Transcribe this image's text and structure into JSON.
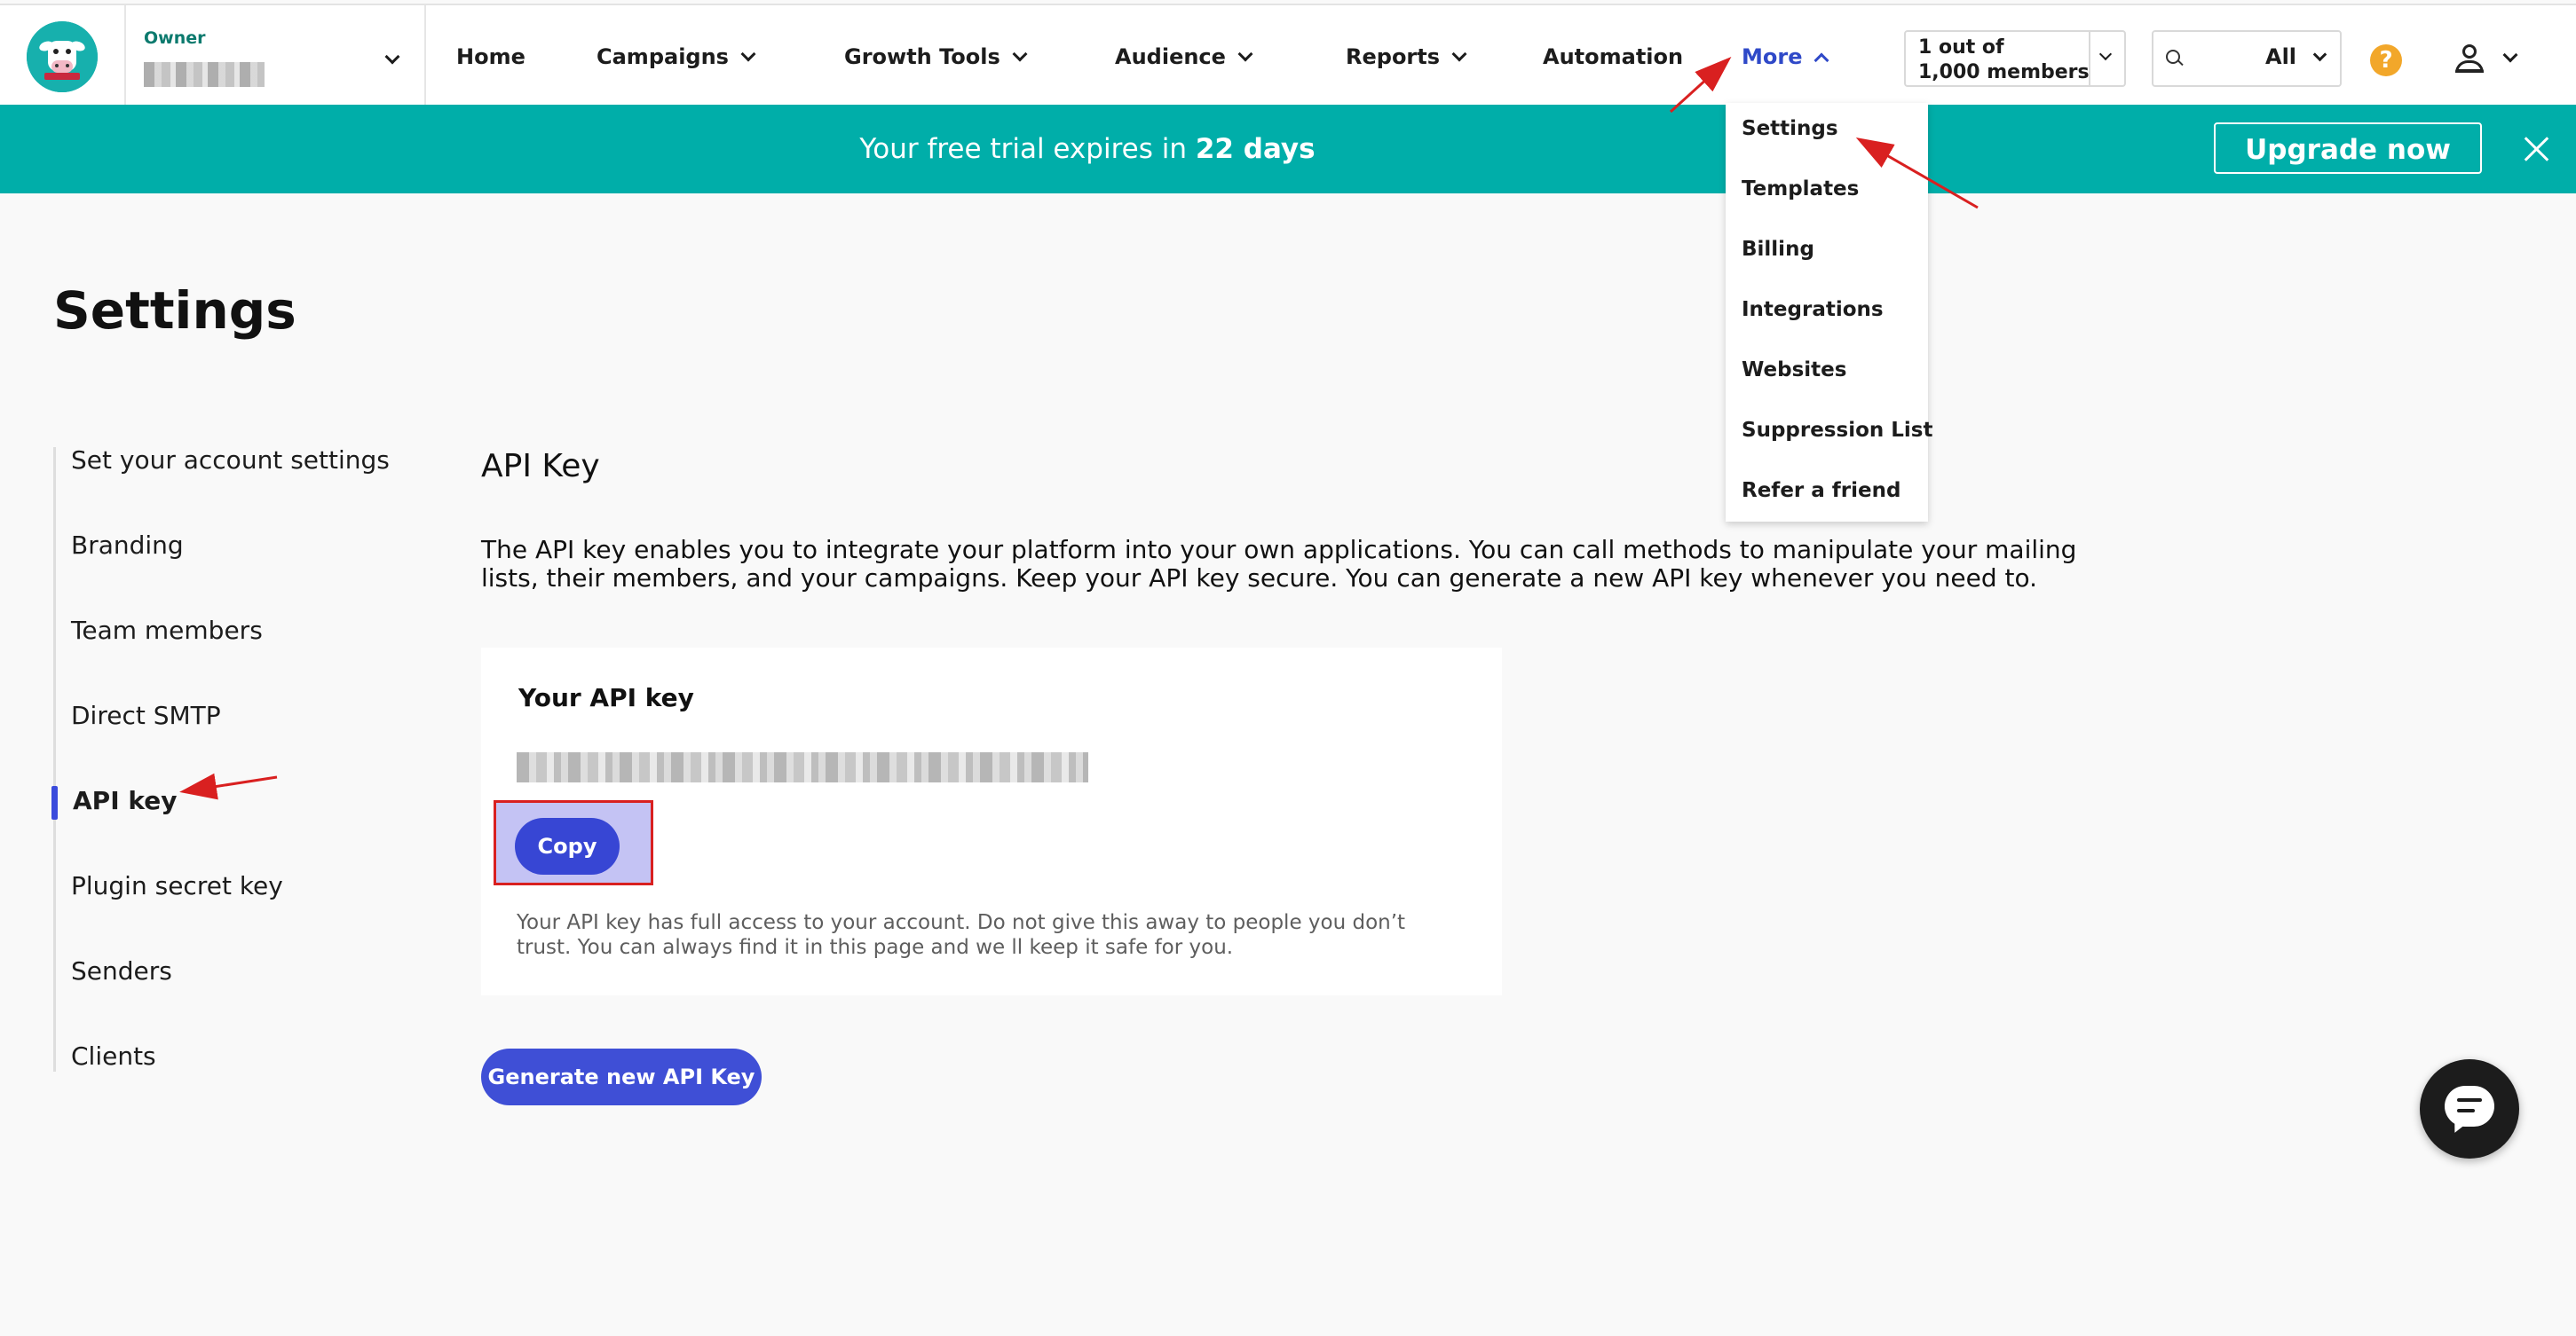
{
  "header": {
    "owner_label": "Owner",
    "nav": [
      {
        "label": "Home"
      },
      {
        "label": "Campaigns"
      },
      {
        "label": "Growth Tools"
      },
      {
        "label": "Audience"
      },
      {
        "label": "Reports"
      },
      {
        "label": "Automation"
      },
      {
        "label": "More"
      }
    ],
    "members_line1": "1 out of",
    "members_line2": "1,000 members",
    "search_scope": "All",
    "help_icon": "?"
  },
  "banner": {
    "text_prefix": "Your free trial expires in ",
    "days": "22 days",
    "upgrade_label": "Upgrade now"
  },
  "page": {
    "title": "Settings",
    "sidebar": [
      {
        "label": "Set your account settings"
      },
      {
        "label": "Branding"
      },
      {
        "label": "Team members"
      },
      {
        "label": "Direct SMTP"
      },
      {
        "label": "API key",
        "active": true
      },
      {
        "label": "Plugin secret key"
      },
      {
        "label": "Senders"
      },
      {
        "label": "Clients"
      }
    ],
    "section_title": "API Key",
    "section_description": "The API key enables you to integrate your platform into your own applications. You can call methods to manipulate your mailing lists, their members, and your campaigns. Keep your API key secure. You can generate a new API key whenever you need to.",
    "card": {
      "title": "Your API key",
      "copy_label": "Copy",
      "note": "Your API key has full access to your account. Do not give this away to people you don’t trust. You can always find it in this page and we ll keep it safe for you."
    },
    "generate_label": "Generate new API Key"
  },
  "more_menu": [
    {
      "label": "Settings"
    },
    {
      "label": "Templates"
    },
    {
      "label": "Billing"
    },
    {
      "label": "Integrations"
    },
    {
      "label": "Websites"
    },
    {
      "label": "Suppression List"
    },
    {
      "label": "Refer a friend"
    }
  ],
  "colors": {
    "banner": "#00aea9",
    "accent": "#3746d4",
    "nav_active": "#2f49c8",
    "highlight_fill": "#c4c3f4",
    "annotation_red": "#d92020",
    "help": "#f2a72a"
  }
}
